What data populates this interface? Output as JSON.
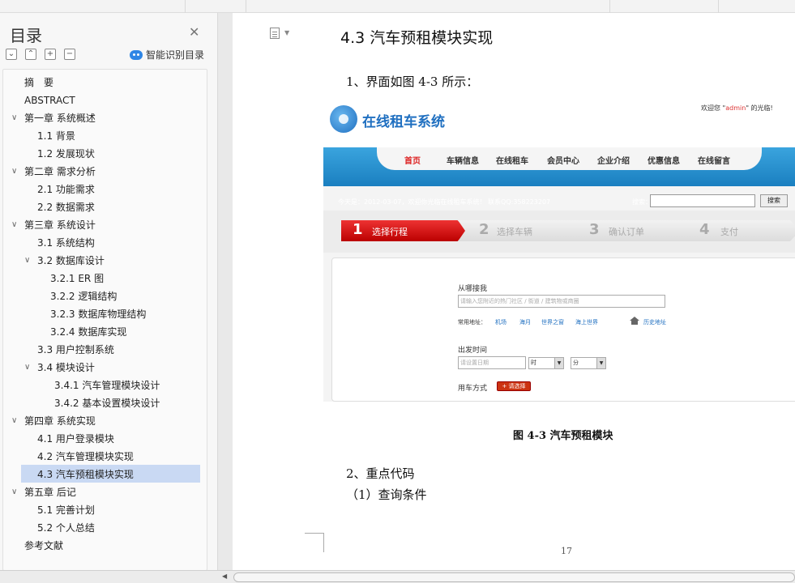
{
  "sidebar": {
    "title": "目录",
    "smart_toc_label": "智能识别目录",
    "toc": [
      {
        "label": "摘　要"
      },
      {
        "label": "ABSTRACT"
      },
      {
        "label": "第一章  系统概述"
      },
      {
        "label": "1.1 背景"
      },
      {
        "label": "1.2 发展现状"
      },
      {
        "label": "第二章  需求分析"
      },
      {
        "label": "2.1  功能需求"
      },
      {
        "label": "2.2  数据需求"
      },
      {
        "label": "第三章  系统设计"
      },
      {
        "label": "3.1 系统结构"
      },
      {
        "label": "3.2  数据库设计"
      },
      {
        "label": "3.2.1 ER 图"
      },
      {
        "label": "3.2.2  逻辑结构"
      },
      {
        "label": "3.2.3  数据库物理结构"
      },
      {
        "label": "3.2.4  数据库实现"
      },
      {
        "label": "3.3 用户控制系统"
      },
      {
        "label": "3.4 模块设计"
      },
      {
        "label": "3.4.1  汽车管理模块设计"
      },
      {
        "label": "3.4.2  基本设置模块设计"
      },
      {
        "label": "第四章  系统实现"
      },
      {
        "label": "4.1 用户登录模块"
      },
      {
        "label": "4.2 汽车管理模块实现"
      },
      {
        "label": "4.3 汽车预租模块实现"
      },
      {
        "label": "第五章  后记"
      },
      {
        "label": "5.1 完善计划"
      },
      {
        "label": "5.2 个人总结"
      },
      {
        "label": "参考文献"
      }
    ],
    "selected_label": "4.3 汽车预租模块实现"
  },
  "document": {
    "heading": "4.3 汽车预租模块实现",
    "para1": "1、界面如图 4-3 所示：",
    "caption": "图 4-3  汽车预租模块",
    "para2": "2、重点代码",
    "para3": "（1）查询条件",
    "page_number": "17"
  },
  "screenshot": {
    "logo_text": "在线租车系统",
    "welcome_prefix": "欢迎您 \"",
    "welcome_user": "admin",
    "welcome_suffix": "\" 的光临!",
    "nav": [
      "首页",
      "车辆信息",
      "在线租车",
      "会员中心",
      "企业介绍",
      "优惠信息",
      "在线留言"
    ],
    "today_text": "今天是：2012-03-07，欢迎你光临在线租车系统！ 联系QQ:358223207",
    "search_label": "搜索：",
    "search_button": "搜索",
    "steps": [
      {
        "num": "1",
        "label": "选择行程"
      },
      {
        "num": "2",
        "label": "选择车辆"
      },
      {
        "num": "3",
        "label": "确认订单"
      },
      {
        "num": "4",
        "label": "支付"
      }
    ],
    "from_label": "从哪接我",
    "from_placeholder": "请输入您附近的热门社区 / 街道 / 建筑物或商圈",
    "common_label": "常用地址：",
    "common_links": [
      "机场",
      "海月",
      "世界之窗",
      "海上世界"
    ],
    "history_link": "历史地址",
    "depart_label": "出发时间",
    "date_placeholder": "请设置日期",
    "hour_value": "时",
    "minute_value": "分",
    "usage_label": "用车方式",
    "usage_button": "+ 请选择"
  },
  "colors": {
    "selected_bg": "#c9d9f3",
    "nav_blue": "#1a7fc0",
    "step_red": "#cc1111"
  }
}
